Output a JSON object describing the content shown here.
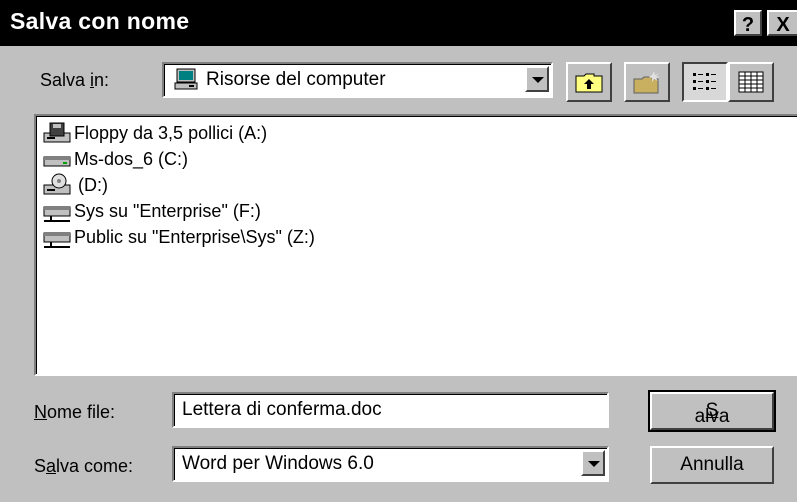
{
  "window": {
    "title": "Salva con nome",
    "help_label": "?",
    "close_label": "X"
  },
  "location": {
    "label_pre": "Salva ",
    "label_accel": "i",
    "label_post": "n:",
    "value": "Risorse del computer",
    "icon": "computer-icon"
  },
  "toolbar": {
    "up_icon": "up-folder-icon",
    "new_folder_icon": "new-folder-icon",
    "list_icon": "list-view-icon",
    "details_icon": "details-view-icon"
  },
  "files": [
    {
      "label": "Floppy da 3,5 pollici (A:)",
      "icon": "floppy-drive-icon"
    },
    {
      "label": "Ms-dos_6 (C:)",
      "icon": "hard-drive-icon"
    },
    {
      "label": "(D:)",
      "icon": "cd-drive-icon"
    },
    {
      "label": "Sys su \"Enterprise\" (F:)",
      "icon": "network-drive-icon"
    },
    {
      "label": "Public su \"Enterprise\\Sys\" (Z:)",
      "icon": "network-drive-icon"
    }
  ],
  "filename": {
    "label_accel": "N",
    "label_post": "ome file:",
    "value": "Lettera di conferma.doc"
  },
  "filetype": {
    "label_pre": "S",
    "label_accel": "a",
    "label_post": "lva come:",
    "value": "Word per Windows 6.0"
  },
  "buttons": {
    "save_accel": "S",
    "save_post": "alva",
    "cancel": "Annulla"
  }
}
